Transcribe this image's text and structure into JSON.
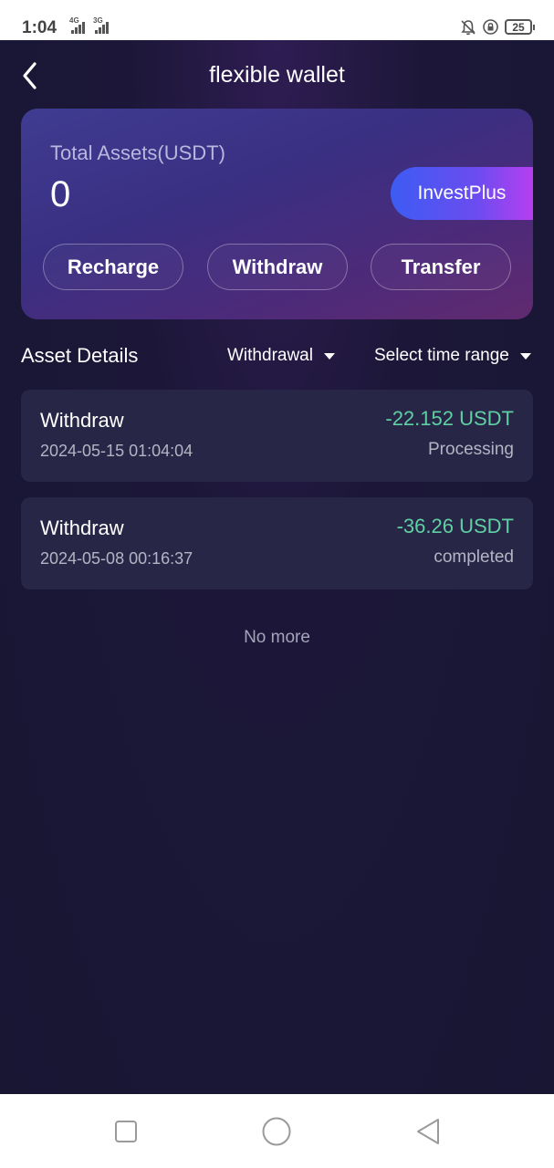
{
  "status_bar": {
    "time": "1:04",
    "network_1": "4G",
    "network_2": "3G",
    "battery": "25",
    "icons": [
      "signal-icon",
      "signal-icon",
      "bell-off-icon",
      "lock-rotation-icon",
      "battery-icon"
    ]
  },
  "header": {
    "title": "flexible wallet",
    "back_icon": "chevron-left-icon"
  },
  "asset_card": {
    "label": "Total Assets(USDT)",
    "value": "0",
    "invest_label": "InvestPlus",
    "actions": {
      "recharge": "Recharge",
      "withdraw": "Withdraw",
      "transfer": "Transfer"
    }
  },
  "details": {
    "title": "Asset Details",
    "type_filter": "Withdrawal",
    "time_filter": "Select time range",
    "filter_icon": "caret-down-icon",
    "records": [
      {
        "type": "Withdraw",
        "time": "2024-05-15 01:04:04",
        "amount": "-22.152 USDT",
        "status": "Processing"
      },
      {
        "type": "Withdraw",
        "time": "2024-05-08 00:16:37",
        "amount": "-36.26 USDT",
        "status": "completed"
      }
    ],
    "end_text": "No more"
  },
  "nav_bar": {
    "icons": [
      "recent-apps-icon",
      "home-icon",
      "back-triangle-icon"
    ]
  },
  "colors": {
    "background": "#1c1738",
    "card_gradient_start": "#3f3c91",
    "card_gradient_end": "#612a6f",
    "invest_gradient_start": "#3d5cf2",
    "invest_gradient_end": "#b63ff0",
    "amount_green": "#5fd0a3",
    "record_bg": "#282646"
  }
}
